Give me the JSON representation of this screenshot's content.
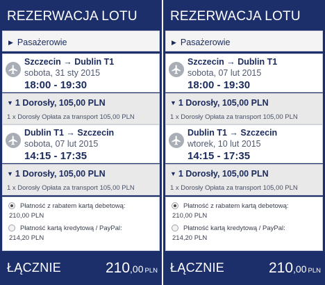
{
  "panels": [
    {
      "title": "REZERWACJA LOTU",
      "passengers_label": "Pasażerowie",
      "flights": [
        {
          "route": "Szczecin → Dublin T1",
          "date": "sobota, 31 sty 2015",
          "time": "18:00 - 19:30",
          "fare_summary": "1 Dorosły, 105,00 PLN",
          "fare_detail": "1 x Dorosły Opłata za transport 105,00 PLN"
        },
        {
          "route": "Dublin T1 → Szczecin",
          "date": "sobota, 07 lut 2015",
          "time": "14:15 - 17:35",
          "fare_summary": "1 Dorosły, 105,00 PLN",
          "fare_detail": "1 x Dorosły Opłata za transport 105,00 PLN"
        }
      ],
      "payment_options": [
        {
          "label": "Płatność z rabatem kartą debetową:",
          "price": "210,00 PLN",
          "selected": true
        },
        {
          "label": "Płatność kartą kredytową / PayPal:",
          "price": "214,20 PLN",
          "selected": false
        }
      ],
      "total": {
        "label": "ŁĄCZNIE",
        "amount_int": "210",
        "amount_dec": ",00",
        "currency": "PLN"
      }
    },
    {
      "title": "REZERWACJA LOTU",
      "passengers_label": "Pasażerowie",
      "flights": [
        {
          "route": "Szczecin → Dublin T1",
          "date": "sobota, 07 lut 2015",
          "time": "18:00 - 19:30",
          "fare_summary": "1 Dorosły, 105,00 PLN",
          "fare_detail": "1 x Dorosły Opłata za transport 105,00 PLN"
        },
        {
          "route": "Dublin T1 → Szczecin",
          "date": "wtorek, 10 lut 2015",
          "time": "14:15 - 17:35",
          "fare_summary": "1 Dorosły, 105,00 PLN",
          "fare_detail": "1 x Dorosły Opłata za transport 105,00 PLN"
        }
      ],
      "payment_options": [
        {
          "label": "Płatność z rabatem kartą debetową:",
          "price": "210,00 PLN",
          "selected": true
        },
        {
          "label": "Płatność kartą kredytową / PayPal:",
          "price": "214,20 PLN",
          "selected": false
        }
      ],
      "total": {
        "label": "ŁĄCZNIE",
        "amount_int": "210",
        "amount_dec": ",00",
        "currency": "PLN"
      }
    }
  ],
  "icons": {
    "passengers_toggle": "triangle-right-icon",
    "fare_toggle": "triangle-down-icon",
    "flight": "airplane-icon"
  },
  "colors": {
    "panel_bg": "#1c2f6b",
    "text_dark": "#1a2a5c",
    "fare_bg": "#e9e9ea"
  }
}
